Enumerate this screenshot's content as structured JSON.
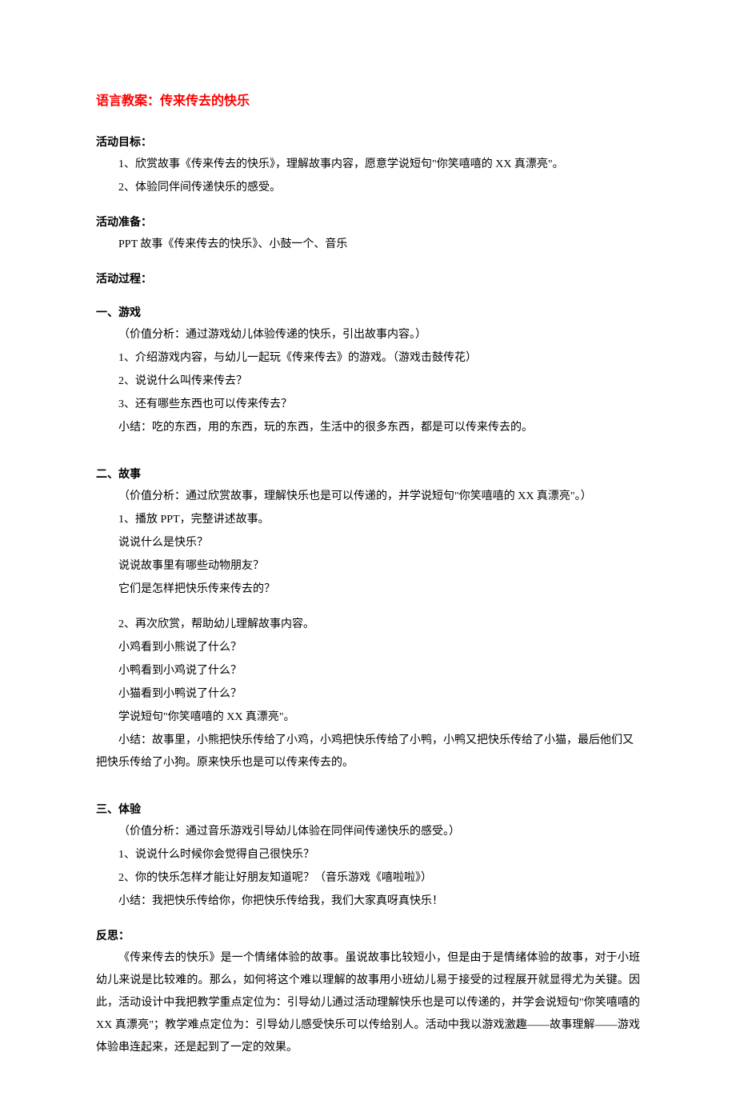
{
  "title": "语言教案：传来传去的快乐",
  "goals": {
    "heading": "活动目标：",
    "items": [
      "1、欣赏故事《传来传去的快乐》，理解故事内容，愿意学说短句\"你笑嘻嘻的 XX 真漂亮\"。",
      "2、体验同伴间传递快乐的感受。"
    ]
  },
  "preparation": {
    "heading": "活动准备：",
    "content": "PPT 故事《传来传去的快乐》、小鼓一个、音乐"
  },
  "process": {
    "heading": "活动过程：",
    "section1": {
      "heading": "一、游戏",
      "analysis": "（价值分析：通过游戏幼儿体验传递的快乐，引出故事内容。）",
      "items": [
        "1、介绍游戏内容，与幼儿一起玩《传来传去》的游戏。（游戏击鼓传花）",
        "2、说说什么叫传来传去？",
        "3、还有哪些东西也可以传来传去？"
      ],
      "summary": "小结：吃的东西，用的东西，玩的东西，生活中的很多东西，都是可以传来传去的。"
    },
    "section2": {
      "heading": "二、故事",
      "analysis": "（价值分析：通过欣赏故事，理解快乐也是可以传递的，并学说短句\"你笑嘻嘻的 XX 真漂亮\"。）",
      "part1": {
        "item": "1、播放 PPT，完整讲述故事。",
        "questions": [
          "说说什么是快乐？",
          "说说故事里有哪些动物朋友？",
          "它们是怎样把快乐传来传去的？"
        ]
      },
      "part2": {
        "item": "2、再次欣赏，帮助幼儿理解故事内容。",
        "questions": [
          "小鸡看到小熊说了什么？",
          "小鸭看到小鸡说了什么？",
          "小猫看到小鸭说了什么？",
          "学说短句\"你笑嘻嘻的 XX 真漂亮\"。"
        ]
      },
      "summary": "小结：故事里，小熊把快乐传给了小鸡，小鸡把快乐传给了小鸭，小鸭又把快乐传给了小猫，最后他们又把快乐传给了小狗。原来快乐也是可以传来传去的。"
    },
    "section3": {
      "heading": "三、体验",
      "analysis": "（价值分析：通过音乐游戏引导幼儿体验在同伴间传递快乐的感受。）",
      "items": [
        "1、说说什么时候你会觉得自己很快乐？",
        "2、你的快乐怎样才能让好朋友知道呢？（音乐游戏《嘻啦啦》）"
      ],
      "summary": "小结：我把快乐传给你，你把快乐传给我，我们大家真呀真快乐！"
    }
  },
  "reflection": {
    "heading": "反思：",
    "content": "《传来传去的快乐》是一个情绪体验的故事。虽说故事比较短小，但是由于是情绪体验的故事，对于小班幼儿来说是比较难的。那么，如何将这个难以理解的故事用小班幼儿易于接受的过程展开就显得尤为关键。因此，活动设计中我把教学重点定位为：引导幼儿通过活动理解快乐也是可以传递的，并学会说短句\"你笑嘻嘻的 XX 真漂亮\"；教学难点定位为：引导幼儿感受快乐可以传给别人。活动中我以游戏激趣——故事理解——游戏体验串连起来，还是起到了一定的效果。"
  }
}
